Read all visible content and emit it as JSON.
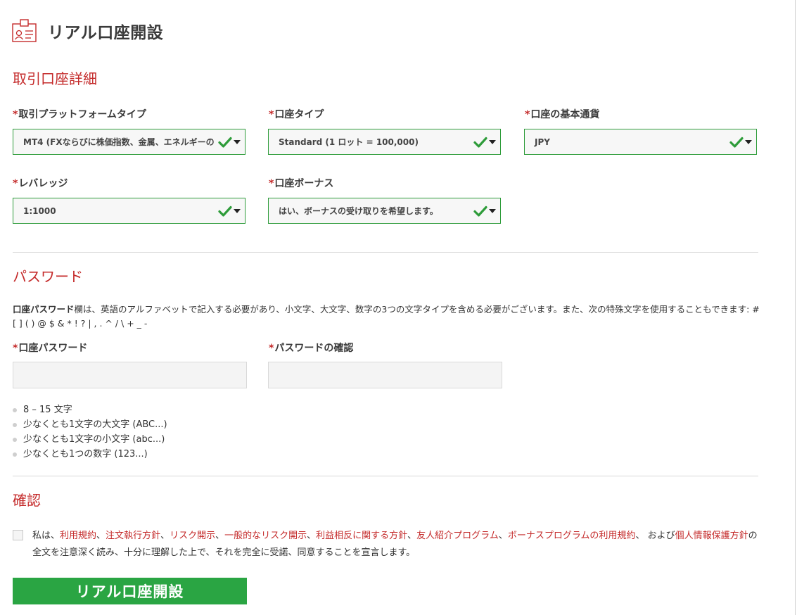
{
  "header": {
    "title": "リアル口座開設"
  },
  "sections": {
    "account": {
      "title": "取引口座詳細"
    },
    "password": {
      "title": "パスワード"
    },
    "confirm": {
      "title": "確認"
    }
  },
  "required_mark": "*",
  "account_fields": {
    "platform": {
      "label": "取引プラットフォームタイプ",
      "value": "MT4 (FXならびに株価指数、金属、エネルギーの"
    },
    "account_type": {
      "label": "口座タイプ",
      "value": "Standard (1 ロット = 100,000)"
    },
    "currency": {
      "label": "口座の基本通貨",
      "value": "JPY"
    },
    "leverage": {
      "label": "レバレッジ",
      "value": "1:1000"
    },
    "bonus": {
      "label": "口座ボーナス",
      "value": "はい、ボーナスの受け取りを希望します。"
    }
  },
  "password": {
    "desc_bold": "口座パスワード",
    "desc_text": "欄は、英語のアルファベットで記入する必要があり、小文字、大文字、数字の3つの文字タイプを含める必要がございます。また、次の特殊文字を使用することもできます: # [ ] ( ) @ $ & * ! ? | , . ^ / \\ + _ -",
    "field_label": "口座パスワード",
    "confirm_label": "パスワードの確認",
    "field_value": "",
    "confirm_value": "",
    "requirements": [
      "8 – 15 文字",
      "少なくとも1文字の大文字 (ABC...)",
      "少なくとも1文字の小文字 (abc...)",
      "少なくとも1つの数字 (123...)"
    ]
  },
  "consent": {
    "prefix": "私は、",
    "link_terms": "利用規約",
    "link_execution": "注文執行方針",
    "link_risk": "リスク開示",
    "link_general_risk": "一般的なリスク開示",
    "link_conflict": "利益相反に関する方針",
    "link_referral": "友人紹介プログラム",
    "link_bonus": "ボーナスプログラムの利用規約",
    "sep": "、",
    "and": "、 および",
    "link_privacy": "個人情報保護方針",
    "suffix": "の全文を注意深く読み、十分に理解した上で、それを完全に受諾、同意することを宣言します。",
    "checked": false
  },
  "submit": {
    "label": "リアル口座開設"
  },
  "colors": {
    "accent_red": "#c42a2a",
    "valid_green": "#2e9c3a",
    "button_green": "#2aa543"
  },
  "icons": {
    "header": "id-card-icon",
    "valid": "check-icon",
    "dropdown": "caret-down-icon",
    "bullet": "bullet-dot-icon"
  }
}
